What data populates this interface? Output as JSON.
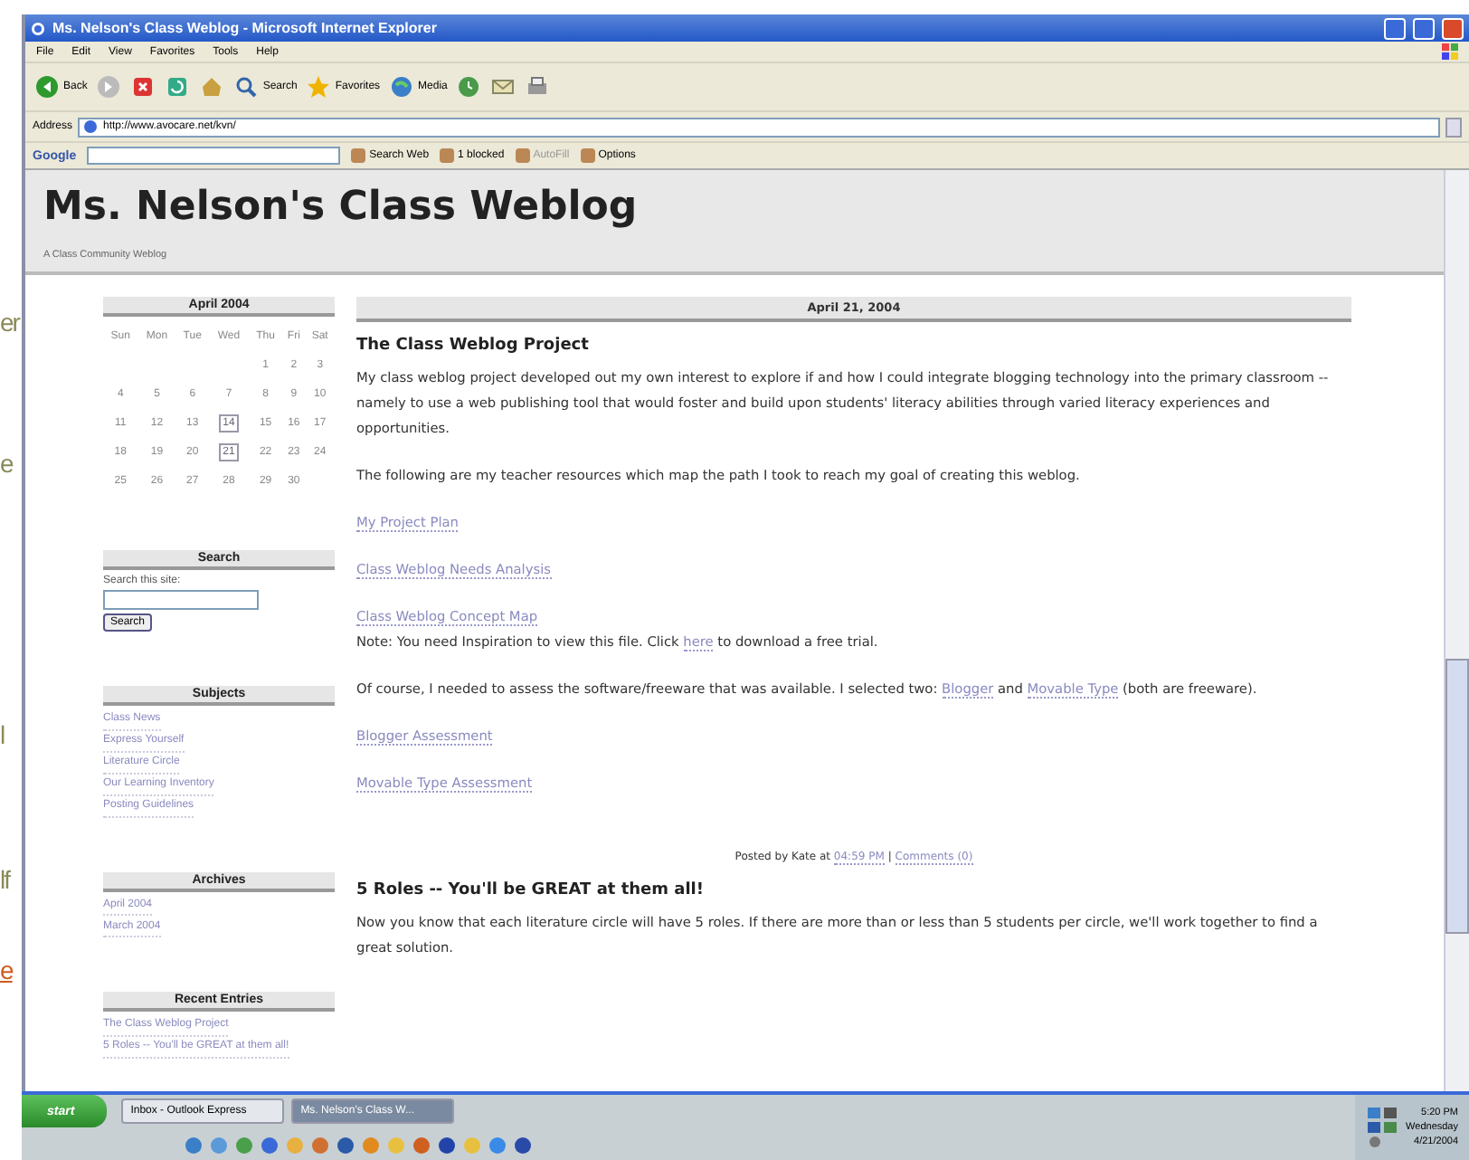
{
  "slide_fragments": [
    {
      "text": "er",
      "color": "#8a8a5a"
    },
    {
      "text": "e",
      "color": "#8a8a5a"
    },
    {
      "text": "l",
      "color": "#8a8a5a"
    },
    {
      "text": "lf",
      "color": "#8a8a5a"
    },
    {
      "text": "e",
      "color": "#d05a20"
    }
  ],
  "window": {
    "title": "Ms. Nelson's Class Weblog - Microsoft Internet Explorer"
  },
  "menu": [
    "File",
    "Edit",
    "View",
    "Favorites",
    "Tools",
    "Help"
  ],
  "toolbar": [
    {
      "kind": "back",
      "label": "Back"
    },
    {
      "kind": "forward"
    },
    {
      "kind": "stop"
    },
    {
      "kind": "refresh"
    },
    {
      "kind": "home"
    },
    {
      "kind": "search",
      "label": "Search"
    },
    {
      "kind": "favorites",
      "label": "Favorites"
    },
    {
      "kind": "media",
      "label": "Media"
    },
    {
      "kind": "history"
    },
    {
      "kind": "mail"
    },
    {
      "kind": "print"
    }
  ],
  "address": {
    "label": "Address",
    "value": "http://www.avocare.net/kvn/"
  },
  "google_bar": {
    "logo": "Google",
    "search_web": "Search Web",
    "blocked": "1 blocked",
    "autofill": "AutoFill",
    "options": "Options"
  },
  "blog": {
    "title": "Ms. Nelson's Class Weblog",
    "subtitle": "A Class Community Weblog"
  },
  "calendar": {
    "title": "April 2004",
    "weekdays": [
      "Sun",
      "Mon",
      "Tue",
      "Wed",
      "Thu",
      "Fri",
      "Sat"
    ],
    "weeks": [
      [
        {
          "day": "1",
          "linked": false
        },
        {
          "day": "2",
          "linked": false
        },
        {
          "day": "3",
          "linked": false
        }
      ],
      [
        {
          "day": "4",
          "linked": false
        },
        {
          "day": "5",
          "linked": false
        },
        {
          "day": "6",
          "linked": false
        },
        {
          "day": "7",
          "linked": false
        },
        {
          "day": "8",
          "linked": false
        },
        {
          "day": "9",
          "linked": false
        },
        {
          "day": "10",
          "linked": false
        }
      ],
      [
        {
          "day": "11",
          "linked": false
        },
        {
          "day": "12",
          "linked": false
        },
        {
          "day": "13",
          "linked": false
        },
        {
          "day": "14",
          "linked": true
        },
        {
          "day": "15",
          "linked": false
        },
        {
          "day": "16",
          "linked": false
        },
        {
          "day": "17",
          "linked": false
        }
      ],
      [
        {
          "day": "18",
          "linked": false
        },
        {
          "day": "19",
          "linked": false
        },
        {
          "day": "20",
          "linked": false
        },
        {
          "day": "21",
          "linked": true
        },
        {
          "day": "22",
          "linked": false
        },
        {
          "day": "23",
          "linked": false
        },
        {
          "day": "24",
          "linked": false
        }
      ],
      [
        {
          "day": "25",
          "linked": false
        },
        {
          "day": "26",
          "linked": false
        },
        {
          "day": "27",
          "linked": false
        },
        {
          "day": "28",
          "linked": false
        },
        {
          "day": "29",
          "linked": false
        },
        {
          "day": "30",
          "linked": false
        }
      ]
    ]
  },
  "search": {
    "title": "Search",
    "label": "Search this site:",
    "button": "Search"
  },
  "sidebar_lists": [
    {
      "title": "Subjects",
      "items": [
        "Class News",
        "Express Yourself",
        "Literature Circle",
        "Our Learning Inventory",
        "Posting Guidelines"
      ]
    },
    {
      "title": "Archives",
      "items": [
        "April 2004",
        "March 2004"
      ]
    },
    {
      "title": "Recent Entries",
      "items": [
        "The Class Weblog Project",
        "5 Roles -- You'll be GREAT at them all!"
      ]
    }
  ],
  "date_header": "April 21, 2004",
  "posts": [
    {
      "title": "The Class Weblog Project",
      "blocks": [
        [
          {
            "kind": "text",
            "text": "My class weblog project developed out my own interest to explore if and how I could integrate blogging technology into the primary classroom -- namely to use a web publishing tool that would foster and build upon students' literacy abilities through varied literacy experiences and opportunities."
          }
        ],
        [
          {
            "kind": "text",
            "text": "The following are my teacher resources which map the path I took to reach my goal of creating this weblog."
          }
        ],
        [
          {
            "kind": "link",
            "text": "My Project Plan"
          }
        ],
        [
          {
            "kind": "link",
            "text": "Class Weblog Needs Analysis"
          }
        ],
        [
          {
            "kind": "link",
            "text": "Class Weblog Concept Map"
          },
          {
            "kind": "break"
          },
          {
            "kind": "text",
            "text": "Note: You need Inspiration to view this file. Click "
          },
          {
            "kind": "link",
            "text": "here"
          },
          {
            "kind": "text",
            "text": " to download a free trial."
          }
        ],
        [
          {
            "kind": "text",
            "text": "Of course, I needed to assess the software/freeware that was available. I selected two: "
          },
          {
            "kind": "link",
            "text": "Blogger"
          },
          {
            "kind": "text",
            "text": " and "
          },
          {
            "kind": "link",
            "text": "Movable Type"
          },
          {
            "kind": "text",
            "text": " (both are freeware)."
          }
        ],
        [
          {
            "kind": "link",
            "text": "Blogger Assessment"
          }
        ],
        [
          {
            "kind": "link",
            "text": "Movable Type Assessment"
          }
        ]
      ],
      "footer": [
        {
          "kind": "text",
          "text": "Posted by Kate at "
        },
        {
          "kind": "link",
          "text": "04:59 PM"
        },
        {
          "kind": "text",
          "text": " | "
        },
        {
          "kind": "link",
          "text": "Comments (0)"
        }
      ]
    },
    {
      "title": "5 Roles -- You'll be GREAT at them all!",
      "blocks": [
        [
          {
            "kind": "text",
            "text": "Now you know that each literature circle will have 5 roles. If there are more than or less than 5 students per circle, we'll work together to find a great solution."
          }
        ]
      ]
    }
  ],
  "taskbar": {
    "start": "start",
    "tasks": [
      {
        "label": "Inbox - Outlook Express",
        "selected": false
      },
      {
        "label": "Ms. Nelson's Class W...",
        "selected": true
      }
    ],
    "clock": [
      "5:20 PM",
      "Wednesday",
      "4/21/2004"
    ]
  }
}
